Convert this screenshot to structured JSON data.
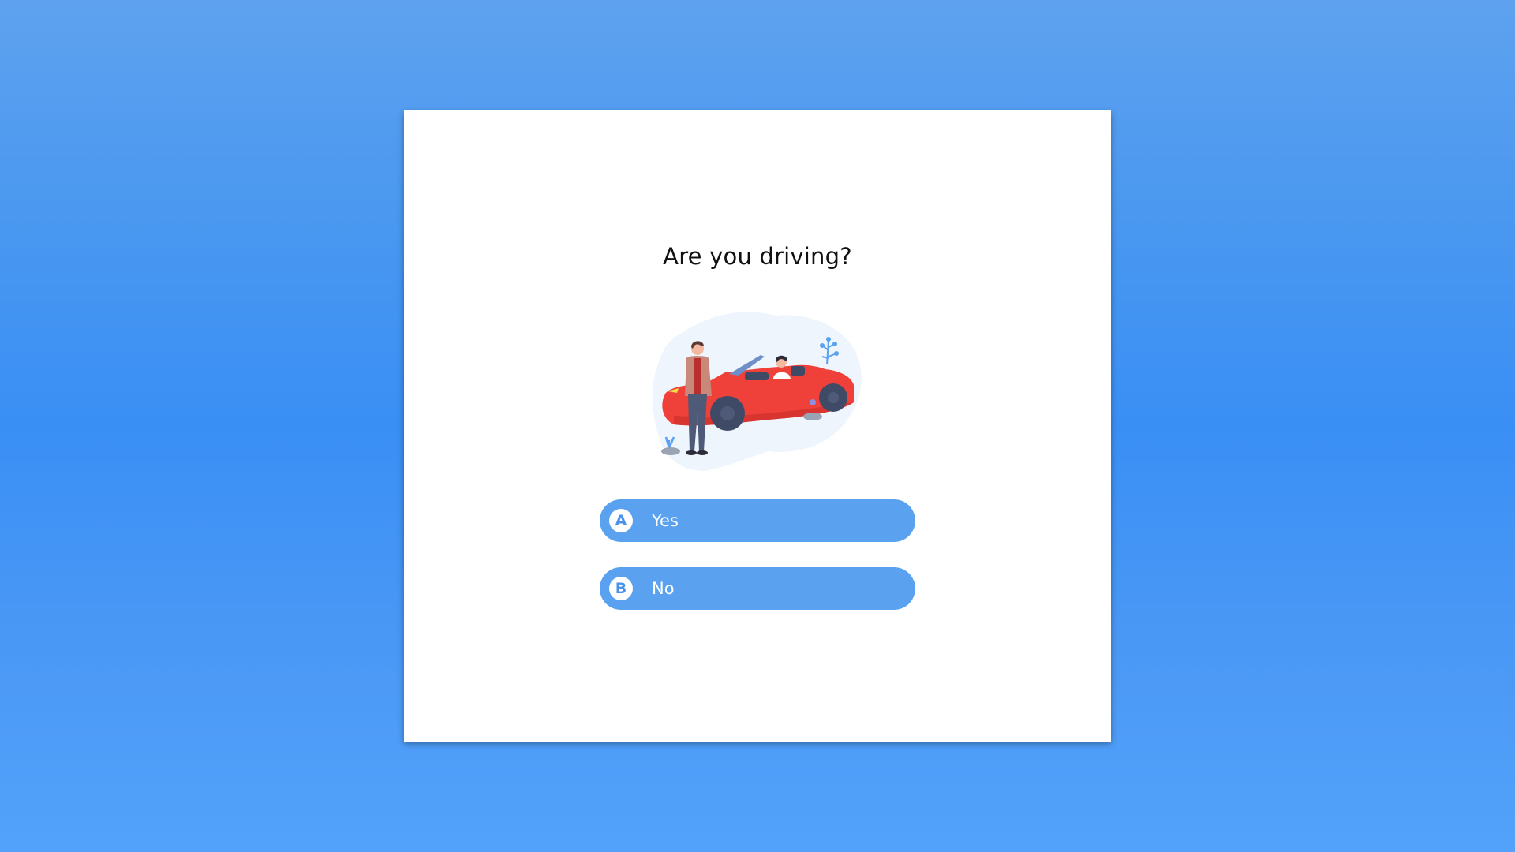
{
  "question": {
    "title": "Are you driving?",
    "illustration": "person-standing-beside-red-convertible-car"
  },
  "options": [
    {
      "letter": "A",
      "label": "Yes"
    },
    {
      "letter": "B",
      "label": "No"
    }
  ],
  "colors": {
    "background": "#3a8ff5",
    "card": "#ffffff",
    "option": "#5aa2ef",
    "option_text": "#ffffff",
    "car": "#f0403a"
  }
}
